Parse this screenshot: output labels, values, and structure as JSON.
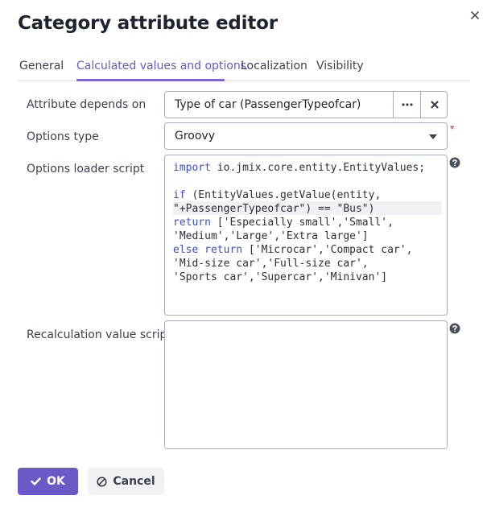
{
  "dialog": {
    "title": "Category attribute editor"
  },
  "tabs": [
    {
      "label": "General"
    },
    {
      "label": "Calculated values and options"
    },
    {
      "label": "Localization"
    },
    {
      "label": "Visibility"
    }
  ],
  "form": {
    "depends_on": {
      "label": "Attribute depends on",
      "value": "Type of car (PassengerTypeofcar)"
    },
    "options_type": {
      "label": "Options type",
      "value": "Groovy",
      "required_mark": "*"
    },
    "options_loader": {
      "label": "Options loader script",
      "lines": [
        "import io.jmix.core.entity.EntityValues;",
        "",
        "if (EntityValues.getValue(entity,",
        "\"+PassengerTypeofcar\") == \"Bus\")",
        "return ['Especially small','Small',",
        "'Medium','Large','Extra large']",
        "else return ['Microcar','Compact car',",
        "'Mid-size car','Full-size car',",
        "'Sports car','Supercar','Minivan']"
      ]
    },
    "recalculation": {
      "label": "Recalculation value script",
      "value": ""
    }
  },
  "buttons": {
    "ok": "OK",
    "cancel": "Cancel"
  },
  "colors": {
    "accent": "#6d58c8",
    "required": "#d92d2d"
  }
}
